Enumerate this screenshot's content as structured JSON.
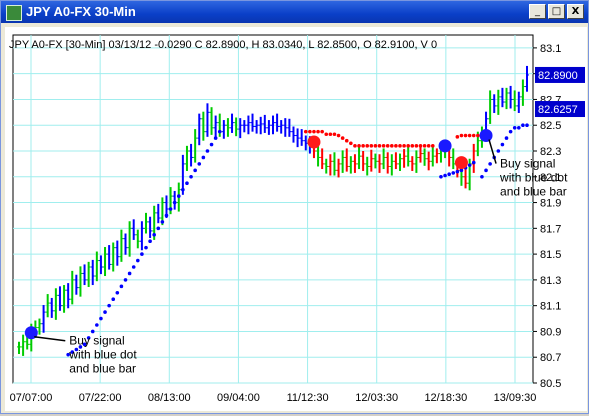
{
  "window": {
    "title": "JPY A0-FX 30-Min",
    "buttons": {
      "minimize": "_",
      "maximize": "□",
      "close": "X"
    }
  },
  "chart_data": {
    "type": "bar",
    "subtype": "ohlc-price-bars",
    "header": "JPY A0-FX [30-Min] 03/13/12  -0.0290 C 82.8900, H 83.0340, L 82.8500, O 82.9100, V 0",
    "ylim": [
      80.5,
      83.2
    ],
    "y_ticks": [
      "83.1",
      "82.9",
      "82.7",
      "82.5",
      "82.3",
      "82.1",
      "81.9",
      "81.7",
      "81.5",
      "81.3",
      "81.1",
      "80.9",
      "80.7",
      "80.5"
    ],
    "x_ticks": [
      "07/07:00",
      "07/22:00",
      "08/13:00",
      "09/04:00",
      "11/12:30",
      "12/03:30",
      "12/18:30",
      "13/09:30"
    ],
    "price_labels": [
      "82.8900",
      "82.6257"
    ],
    "colors": {
      "up_trend": "#0000ff",
      "down_trend": "#ff0000",
      "neutral": "#00cc00",
      "grid": "#a0eeee"
    },
    "annotations": [
      {
        "text": "Buy signal\nwith blue dot\nand blue bar",
        "at_bar": 3
      },
      {
        "text": "Buy signal\nwith blue dot\nand blue bar",
        "at_bar": 114
      }
    ],
    "signals": [
      {
        "bar": 3,
        "value": 80.89,
        "color": "blue"
      },
      {
        "bar": 72,
        "value": 82.37,
        "color": "red"
      },
      {
        "bar": 104,
        "value": 82.34,
        "color": "blue"
      },
      {
        "bar": 108,
        "value": 82.21,
        "color": "red"
      },
      {
        "bar": 114,
        "value": 82.42,
        "color": "blue"
      }
    ],
    "segments": [
      {
        "bars": [
          0,
          4
        ],
        "color": "green",
        "close": [
          80.78,
          80.82,
          80.8,
          80.92,
          80.93
        ]
      },
      {
        "bars": [
          5,
          28
        ],
        "color": "green-blue",
        "close": [
          80.96,
          81.05,
          81.12,
          81.06,
          81.18,
          81.1,
          81.22,
          81.15,
          81.3,
          81.24,
          81.35,
          81.3,
          81.4,
          81.33,
          81.45,
          81.4,
          81.5,
          81.42,
          81.55,
          81.48,
          81.62,
          81.55,
          81.7,
          81.65
        ]
      },
      {
        "bars": [
          29,
          54
        ],
        "color": "green-blue",
        "close": [
          81.6,
          81.7,
          81.75,
          81.68,
          81.82,
          81.78,
          81.9,
          81.85,
          81.95,
          81.9,
          82.0,
          82.2,
          82.3,
          82.25,
          82.4,
          82.55,
          82.45,
          82.6,
          82.48,
          82.52,
          82.45,
          82.5,
          82.48,
          82.52,
          82.47,
          82.5
        ]
      },
      {
        "bars": [
          55,
          71
        ],
        "color": "blue",
        "close": [
          82.5,
          82.52,
          82.49,
          82.5,
          82.51,
          82.48,
          82.5,
          82.52,
          82.49,
          82.5,
          82.48,
          82.45,
          82.42,
          82.4,
          82.38,
          82.36,
          82.35
        ]
      },
      {
        "bars": [
          72,
          103
        ],
        "color": "red-green",
        "close": [
          82.3,
          82.25,
          82.2,
          82.18,
          82.22,
          82.15,
          82.2,
          82.25,
          82.18,
          82.22,
          82.2,
          82.26,
          82.2,
          82.18,
          82.24,
          82.22,
          82.2,
          82.25,
          82.18,
          82.22,
          82.2,
          82.24,
          82.26,
          82.22,
          82.2,
          82.25,
          82.28,
          82.24,
          82.22,
          82.26,
          82.28,
          82.3
        ]
      },
      {
        "bars": [
          104,
          112
        ],
        "color": "green-red",
        "close": [
          82.3,
          82.25,
          82.2,
          82.15,
          82.1,
          82.05,
          82.2,
          82.3,
          82.38
        ]
      },
      {
        "bars": [
          113,
          124
        ],
        "color": "green-blue",
        "close": [
          82.45,
          82.55,
          82.7,
          82.65,
          82.72,
          82.68,
          82.75,
          82.7,
          82.65,
          82.72,
          82.8,
          82.89
        ]
      }
    ],
    "stops": {
      "blue_left": [
        80.72,
        80.74,
        80.76,
        80.78,
        80.8,
        80.85,
        80.9,
        80.95,
        81.0,
        81.05,
        81.1,
        81.15,
        81.2,
        81.25,
        81.3,
        81.35,
        81.4,
        81.45,
        81.5,
        81.55,
        81.6,
        81.65,
        81.7,
        81.75,
        81.8,
        81.85,
        81.9,
        81.95,
        82.0,
        82.05,
        82.1,
        82.15,
        82.2,
        82.25,
        82.3,
        82.35,
        82.4,
        82.45
      ],
      "red_mid": [
        82.45,
        82.45,
        82.45,
        82.45,
        82.45,
        82.43,
        82.43,
        82.43,
        82.42,
        82.4,
        82.38,
        82.36,
        82.34,
        82.34,
        82.34,
        82.34,
        82.34,
        82.34,
        82.34,
        82.34,
        82.34,
        82.34,
        82.34,
        82.34,
        82.34,
        82.34,
        82.34,
        82.34,
        82.34,
        82.34,
        82.34,
        82.34
      ],
      "blue_mid": [
        82.1,
        82.11,
        82.12,
        82.13,
        82.14,
        82.15,
        82.17,
        82.19,
        82.21
      ],
      "red_late": [
        82.41,
        82.42,
        82.42,
        82.42,
        82.42,
        82.42,
        82.42,
        82.42,
        82.42
      ],
      "blue_late": [
        82.1,
        82.15,
        82.2,
        82.25,
        82.3,
        82.35,
        82.4,
        82.45,
        82.48,
        82.48,
        82.5,
        82.5
      ]
    }
  }
}
